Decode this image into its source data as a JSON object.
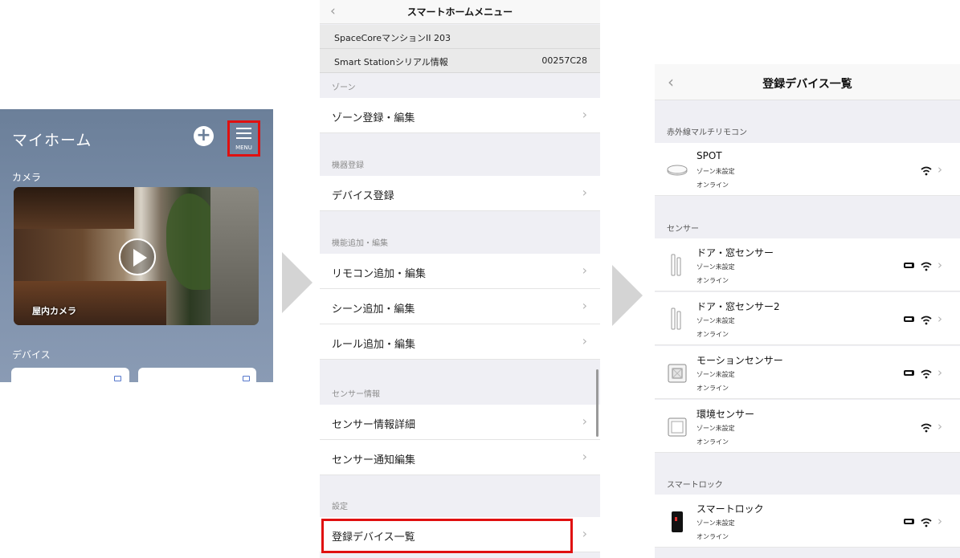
{
  "home": {
    "title": "マイホーム",
    "plus_glyph": "+",
    "menu_label": "MENU",
    "camera_section": "カメラ",
    "camera_name": "屋内カメラ",
    "device_section": "デバイス"
  },
  "menu": {
    "back_glyph": "‹",
    "title": "スマートホームメニュー",
    "property_name": "SpaceCoreマンションII 203",
    "serial_label": "Smart Stationシリアル情報",
    "serial_value": "00257C28",
    "sections": [
      {
        "header": "ゾーン",
        "items": [
          "ゾーン登録・編集"
        ]
      },
      {
        "header": "機器登録",
        "items": [
          "デバイス登録"
        ]
      },
      {
        "header": "機能追加・編集",
        "items": [
          "リモコン追加・編集",
          "シーン追加・編集",
          "ルール追加・編集"
        ]
      },
      {
        "header": "センサー情報",
        "items": [
          "センサー情報詳細",
          "センサー通知編集"
        ]
      },
      {
        "header": "設定",
        "items": [
          "登録デバイス一覧"
        ]
      }
    ],
    "chevron": "›"
  },
  "devices": {
    "back_glyph": "‹",
    "title": "登録デバイス一覧",
    "chevron": "›",
    "groups": [
      {
        "header": "赤外線マルチリモコン",
        "items": [
          {
            "name": "SPOT",
            "zone": "ゾーン未設定",
            "status": "オンライン",
            "battery": false,
            "icon": "ir-remote-icon"
          }
        ]
      },
      {
        "header": "センサー",
        "items": [
          {
            "name": "ドア・窓センサー",
            "zone": "ゾーン未設定",
            "status": "オンライン",
            "battery": true,
            "icon": "door-sensor-icon"
          },
          {
            "name": "ドア・窓センサー2",
            "zone": "ゾーン未設定",
            "status": "オンライン",
            "battery": true,
            "icon": "door-sensor-icon"
          },
          {
            "name": "モーションセンサー",
            "zone": "ゾーン未設定",
            "status": "オンライン",
            "battery": true,
            "icon": "motion-sensor-icon"
          },
          {
            "name": "環境センサー",
            "zone": "ゾーン未設定",
            "status": "オンライン",
            "battery": false,
            "icon": "environment-sensor-icon"
          }
        ]
      },
      {
        "header": "スマートロック",
        "items": [
          {
            "name": "スマートロック",
            "zone": "ゾーン未設定",
            "status": "オンライン",
            "battery": true,
            "icon": "smart-lock-icon"
          }
        ]
      }
    ]
  },
  "colors": {
    "highlight": "#e01010",
    "accent": "#5577cc"
  }
}
